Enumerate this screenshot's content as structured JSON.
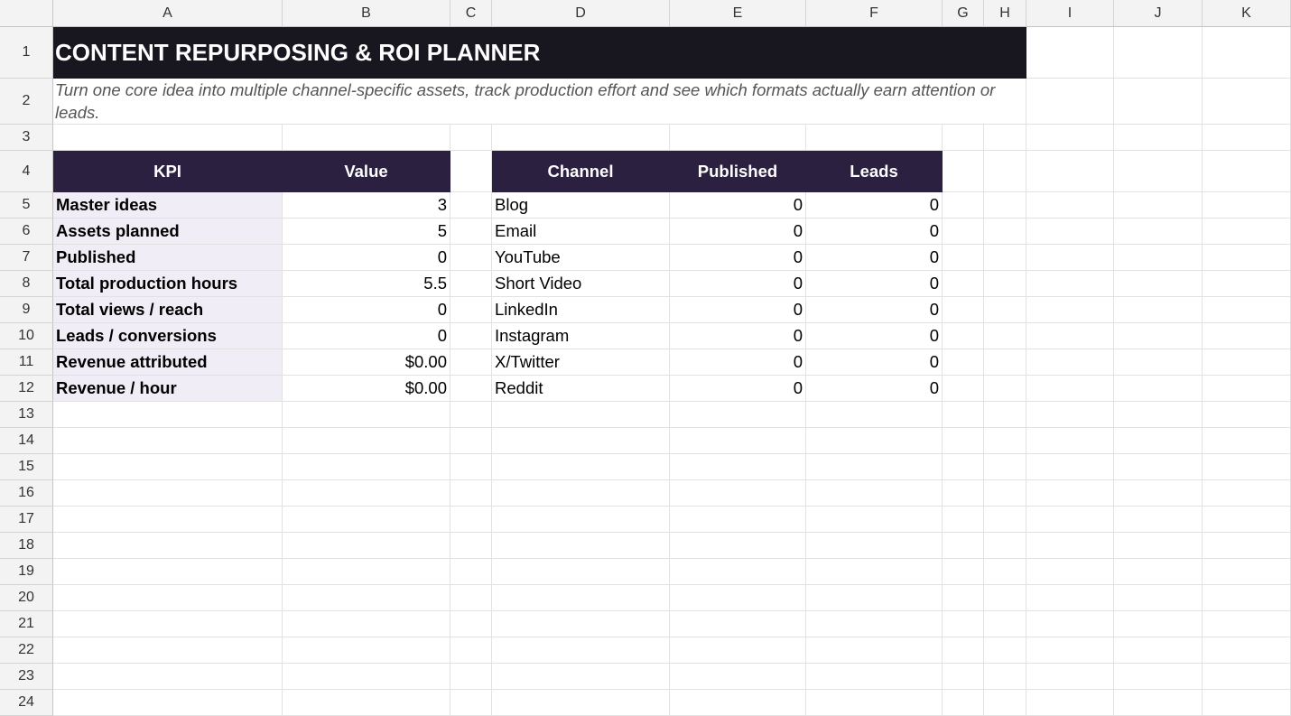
{
  "columns": [
    "A",
    "B",
    "C",
    "D",
    "E",
    "F",
    "G",
    "H",
    "I",
    "J",
    "K"
  ],
  "rows": [
    "1",
    "2",
    "3",
    "4",
    "5",
    "6",
    "7",
    "8",
    "9",
    "10",
    "11",
    "12",
    "13",
    "14",
    "15",
    "16",
    "17",
    "18",
    "19",
    "20",
    "21",
    "22",
    "23",
    "24"
  ],
  "title": "CONTENT REPURPOSING & ROI PLANNER",
  "subtitle": "Turn one core idea into multiple channel-specific assets, track production effort and see which formats actually earn attention or leads.",
  "kpi_table": {
    "headers": [
      "KPI",
      "Value"
    ],
    "rows": [
      {
        "label": "Master ideas",
        "value": "3"
      },
      {
        "label": "Assets planned",
        "value": "5"
      },
      {
        "label": "Published",
        "value": "0"
      },
      {
        "label": "Total production hours",
        "value": "5.5"
      },
      {
        "label": "Total views / reach",
        "value": "0"
      },
      {
        "label": "Leads / conversions",
        "value": "0"
      },
      {
        "label": "Revenue attributed",
        "value": "$0.00"
      },
      {
        "label": "Revenue / hour",
        "value": "$0.00"
      }
    ]
  },
  "channel_table": {
    "headers": [
      "Channel",
      "Published",
      "Leads"
    ],
    "rows": [
      {
        "channel": "Blog",
        "published": "0",
        "leads": "0"
      },
      {
        "channel": "Email",
        "published": "0",
        "leads": "0"
      },
      {
        "channel": "YouTube",
        "published": "0",
        "leads": "0"
      },
      {
        "channel": "Short Video",
        "published": "0",
        "leads": "0"
      },
      {
        "channel": "LinkedIn",
        "published": "0",
        "leads": "0"
      },
      {
        "channel": "Instagram",
        "published": "0",
        "leads": "0"
      },
      {
        "channel": "X/Twitter",
        "published": "0",
        "leads": "0"
      },
      {
        "channel": "Reddit",
        "published": "0",
        "leads": "0"
      }
    ]
  },
  "colors": {
    "title_bg": "#18161f",
    "header_bg": "#2b2040",
    "kpi_label_bg": "#f0edf6",
    "gridline": "#e2e2e2",
    "header_chrome": "#f3f3f3"
  }
}
